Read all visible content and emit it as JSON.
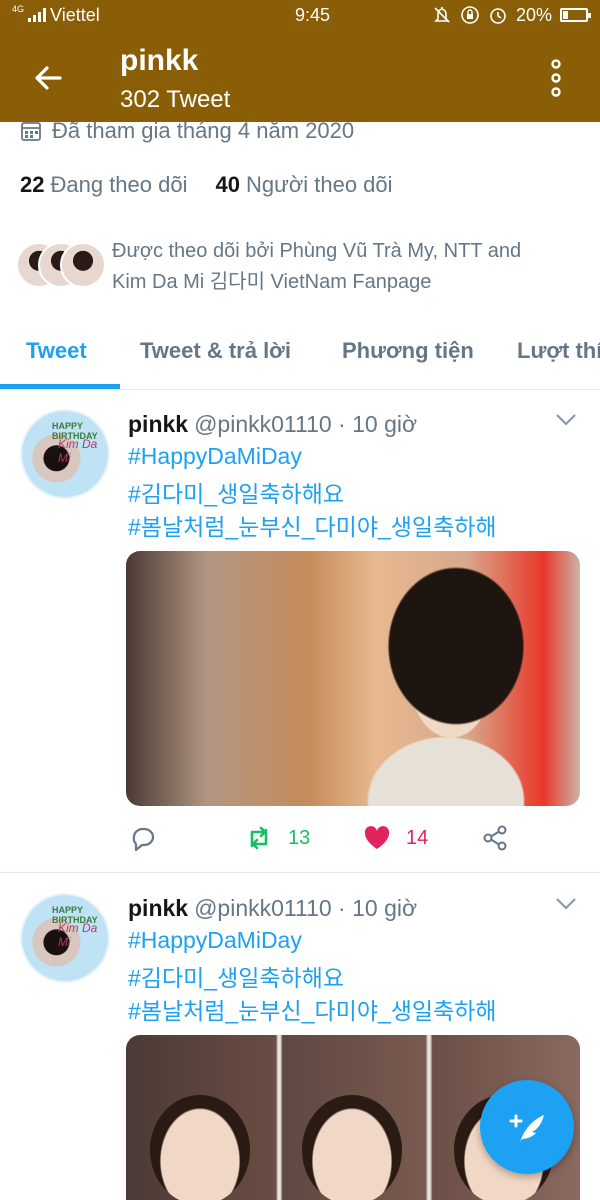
{
  "status_bar": {
    "network_type": "4G",
    "carrier": "Viettel",
    "time": "9:45",
    "battery": "20%",
    "battery_level": 0.2,
    "icons": [
      "mute-icon",
      "rotation-lock-icon",
      "alarm-icon",
      "battery-icon"
    ]
  },
  "header": {
    "name": "pinkk",
    "tweet_count": "302 Tweet",
    "bar_color": "#8a5e07"
  },
  "profile": {
    "joined": "Đã tham gia tháng 4 năm 2020",
    "following_count": "22",
    "following_label": "Đang theo dõi",
    "followers_count": "40",
    "followers_label": "Người theo dõi",
    "followed_by_line1": "Được theo dõi bởi Phùng Vũ Trà My, NTT and",
    "followed_by_line2": "Kim Da Mi 김다미 VietNam Fanpage"
  },
  "tabs": [
    {
      "label": "Tweet",
      "active": true
    },
    {
      "label": "Tweet & trả lời",
      "active": false
    },
    {
      "label": "Phương tiện",
      "active": false
    },
    {
      "label": "Lượt thích",
      "active": false
    }
  ],
  "accent_color": "#1da1f2",
  "avatar_text": {
    "line1": "HAPPY BIRTHDAY",
    "line2": "Kim Da Mi"
  },
  "tweets": [
    {
      "name": "pinkk",
      "meta": "@pinkk01110 · 10 giờ",
      "lines": [
        "#HappyDaMiDay",
        "#김다미_생일축하해요",
        "#봄날처럼_눈부신_다미야_생일축하해"
      ],
      "retweets": "13",
      "likes": "14",
      "liked": true
    },
    {
      "name": "pinkk",
      "meta": "@pinkk01110 · 10 giờ",
      "lines": [
        "#HappyDaMiDay",
        "#김다미_생일축하해요",
        "#봄날처럼_눈부신_다미야_생일축하해"
      ]
    }
  ]
}
